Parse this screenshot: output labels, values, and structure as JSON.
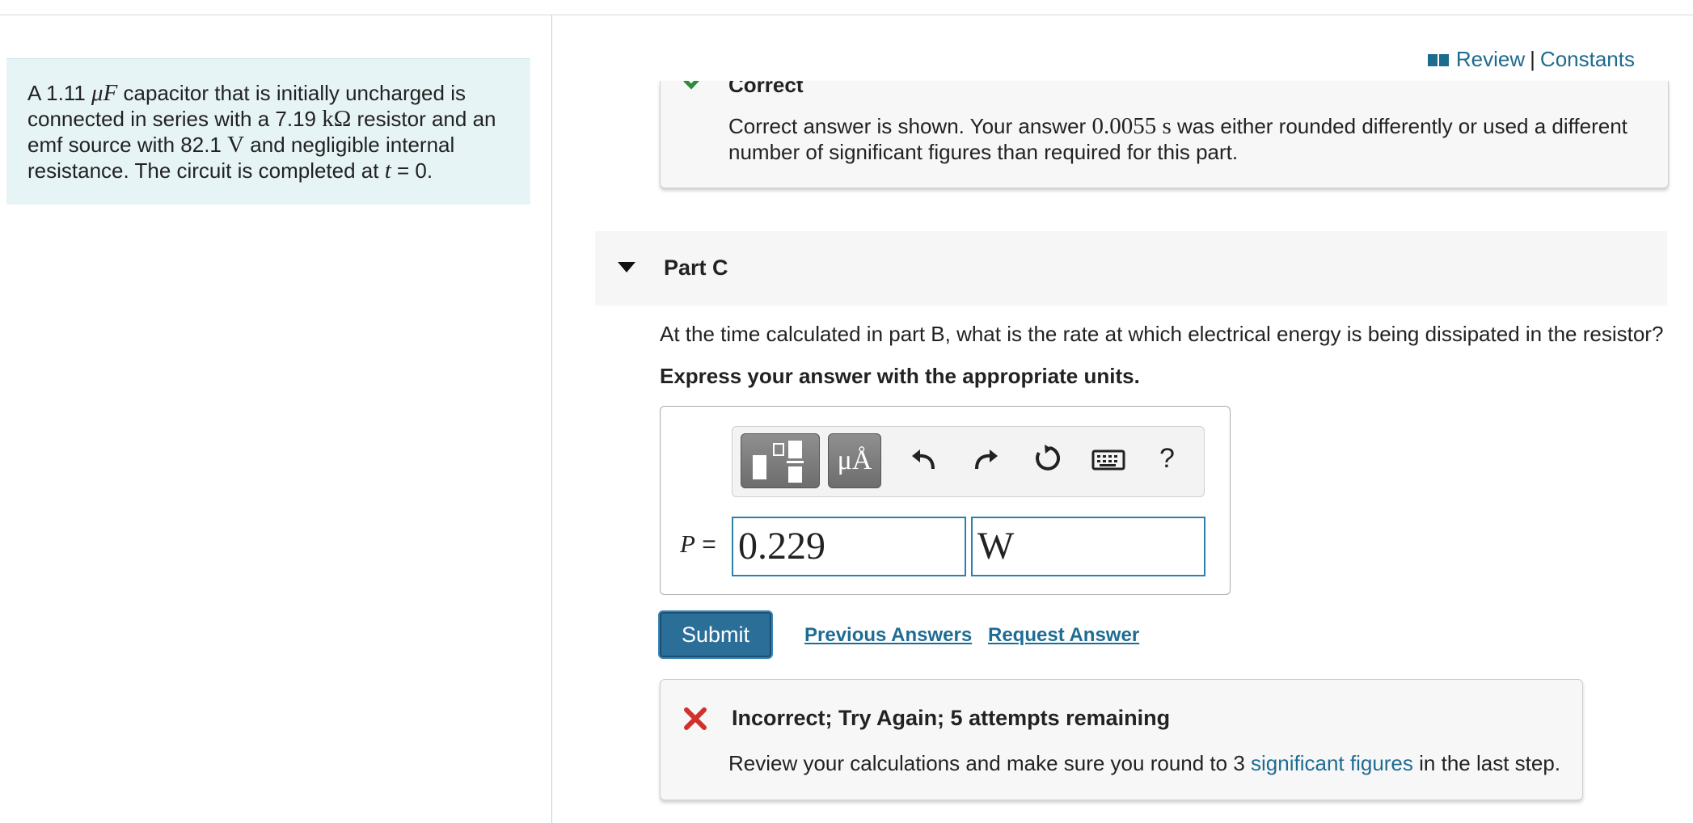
{
  "problem": {
    "t1": "A 1.11 ",
    "cap_unit": "μF",
    "t2": " capacitor that is initially uncharged is connected in series with a 7.19 ",
    "res_unit": "kΩ",
    "t3": " resistor and an emf source with 82.1 ",
    "emf_unit": "V",
    "t4": " and negligible internal resistance. The circuit is completed at ",
    "t_var": "t",
    "t5": " = 0."
  },
  "header": {
    "review": "Review",
    "separator": "|",
    "constants": "Constants"
  },
  "part_b_feedback": {
    "title": "Correct",
    "msg_a": "Correct answer is shown. Your answer ",
    "answer": "0.0055 s",
    "msg_b": " was either rounded differently or used a different number of significant figures than required for this part."
  },
  "part_c": {
    "title": "Part C",
    "question": "At the time calculated in part B, what is the rate at which electrical energy is being dissipated in the resistor?",
    "instruction": "Express your answer with the appropriate units.",
    "toolbar": {
      "units_label": "μÅ",
      "help_label": "?"
    },
    "variable": "P",
    "equals": " =",
    "value": "0.229",
    "unit": "W",
    "submit_label": "Submit",
    "previous_answers_label": "Previous Answers",
    "request_answer_label": "Request Answer"
  },
  "feedback": {
    "title": "Incorrect; Try Again; 5 attempts remaining",
    "msg_a": "Review your calculations and make sure you round to 3 ",
    "link": "significant figures",
    "msg_b": " in the last step."
  },
  "colors": {
    "link": "#1f6c93",
    "correct": "#2e8b3a",
    "incorrect": "#d0312d",
    "panel": "#e6f4f6",
    "submit": "#2b6f99"
  }
}
